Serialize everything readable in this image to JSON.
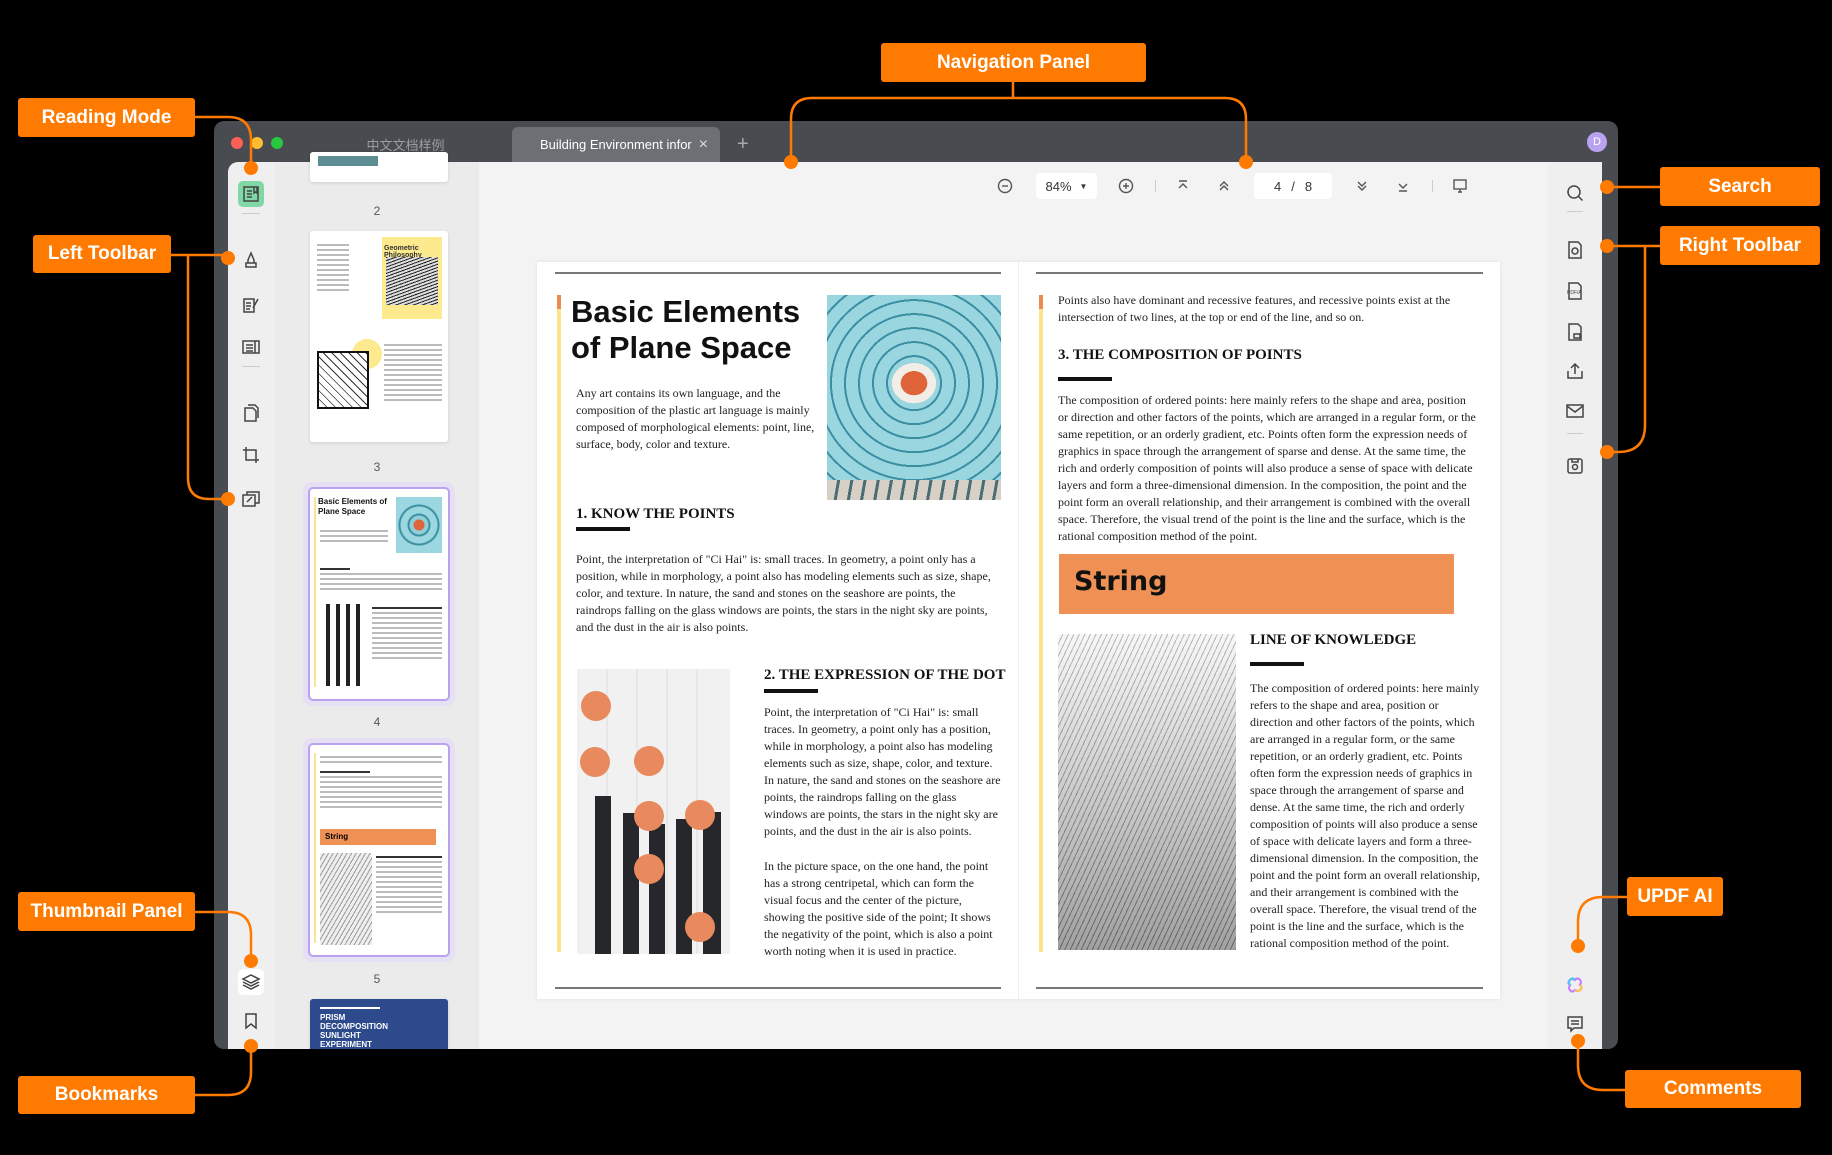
{
  "window": {
    "tabs": [
      {
        "label": "中文文档样例",
        "active": false
      },
      {
        "label": "Building Environment infor",
        "active": true
      }
    ],
    "new_tab": "+",
    "close_tab": "×",
    "avatar": "D",
    "traffic_lights": [
      "#fe5f57",
      "#febc2e",
      "#28c840"
    ]
  },
  "nav": {
    "zoom": "84%",
    "current_page": "4",
    "separator": "/",
    "total_pages": "8"
  },
  "left_toolbar": [
    "reading-mode",
    "comment",
    "edit",
    "page-organize",
    "pages",
    "crop",
    "convert"
  ],
  "left_bottom": [
    "thumbnails",
    "bookmarks"
  ],
  "right_toolbar": [
    "search",
    "ocr",
    "pdf-a",
    "protect",
    "share",
    "email",
    "save"
  ],
  "right_bottom": [
    "updf-ai",
    "comments"
  ],
  "thumbnails": {
    "pages": [
      "2",
      "3",
      "4",
      "5"
    ],
    "p3_title": "Geometric Philosophy",
    "p4_title": "Basic Elements of Plane Space",
    "p5_banner": "String",
    "p6_title": "PRISM DECOMPOSITION SUNLIGHT EXPERIMENT",
    "selected": "4"
  },
  "doc": {
    "title": "Basic Elements of Plane Space",
    "intro": "Any art contains its own language, and the composition of the plastic art language is mainly composed of morphological elements: point, line, surface, body, color and texture.",
    "h1": "1. KNOW THE POINTS",
    "p1": "Point, the interpretation of \"Ci Hai\" is: small traces. In geometry, a point only has a position, while in morphology, a point also has modeling elements such as size, shape, color, and texture. In nature, the sand and stones on the seashore are points, the raindrops falling on the glass windows are points, the stars in the night sky are points, and the dust in the air is also points.",
    "h2": "2. THE EXPRESSION OF THE DOT",
    "p2a": "Point, the interpretation of \"Ci Hai\" is: small traces. In geometry, a point only has a position, while in morphology, a point also has modeling elements such as size, shape, color, and texture. In nature, the sand and stones on the seashore are points, the raindrops falling on the glass windows are points, the stars in the night sky are points, and the dust in the air is also points.",
    "p2b": "In the picture space, on the one hand, the point has a strong centripetal, which can form the visual focus and the center of the picture, showing the positive side of the point; It shows the negativity of the point, which is also a point worth noting when it is used in practice.",
    "p3_lead": "Points also have dominant and recessive features, and recessive points exist at the intersection of two lines, at the top or end of the line, and so on.",
    "h3": "3. THE COMPOSITION OF POINTS",
    "p3": "The composition of ordered points: here mainly refers to the shape and area, position or direction and other factors of the points, which are arranged in a regular form, or the same repetition, or an orderly gradient, etc. Points often form the expression needs of graphics in space through the arrangement of sparse and dense. At the same time, the rich and orderly composition of points will also produce a sense of space with delicate layers and form a three-dimensional dimension. In the composition, the point and the point form an overall relationship, and their arrangement is combined with the overall space. Therefore, the visual trend of the point is the line and the surface, which is the rational composition method of the point.",
    "banner": "String",
    "h4": "LINE OF KNOWLEDGE",
    "p4": "The composition of ordered points: here mainly refers to the shape and area, position or direction and other factors of the points, which are arranged in a regular form, or the same repetition, or an orderly gradient, etc. Points often form the expression needs of graphics in space through the arrangement of sparse and dense. At the same time, the rich and orderly composition of points will also produce a sense of space with delicate layers and form a three-dimensional dimension. In the composition, the point and the point form an overall relationship, and their arrangement is combined with the overall space. Therefore, the visual trend of the point is the line and the surface, which is the rational composition method of the point."
  },
  "callouts": {
    "reading_mode": "Reading Mode",
    "left_toolbar": "Left Toolbar",
    "thumbnail_panel": "Thumbnail Panel",
    "bookmarks": "Bookmarks",
    "navigation_panel": "Navigation Panel",
    "search": "Search",
    "right_toolbar": "Right Toolbar",
    "updf_ai": "UPDF AI",
    "comments": "Comments"
  },
  "colors": {
    "accent": "#ff7a00",
    "banner": "#ef9155",
    "highlight_bar": "#fbe58a",
    "selection": "#b9a3f0",
    "active_tool": "#7fd8a6"
  }
}
